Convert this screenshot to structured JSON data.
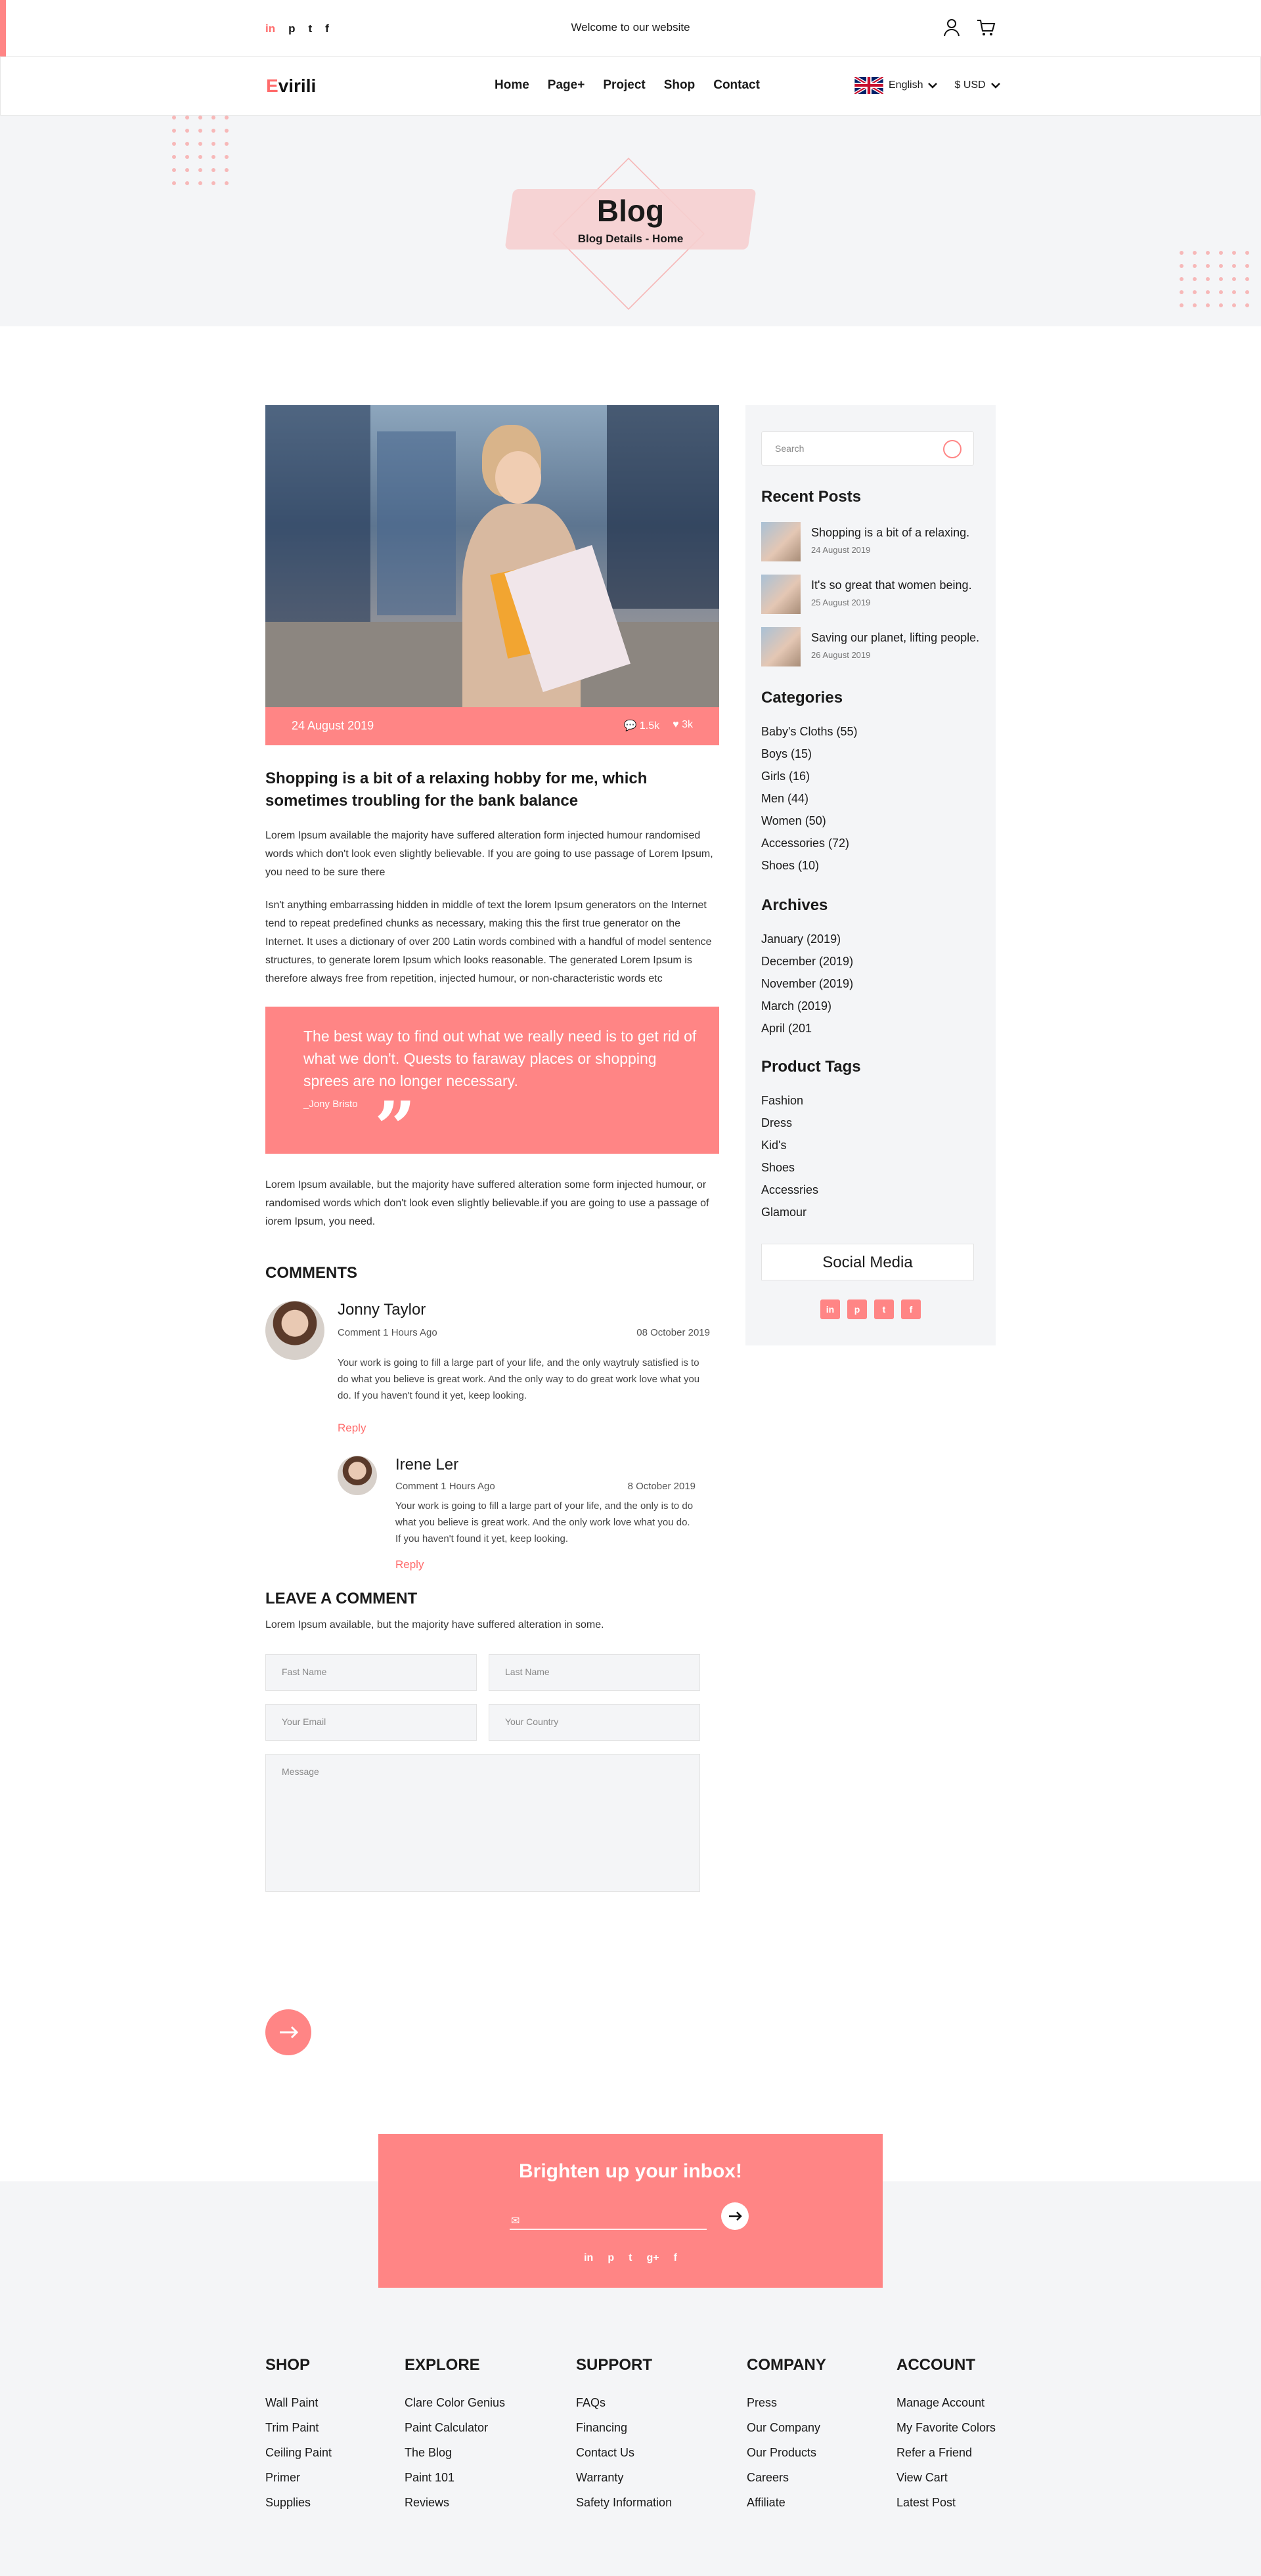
{
  "topbar": {
    "social": [
      "in",
      "p",
      "t",
      "f"
    ],
    "welcome": "Welcome to our website",
    "icons": [
      "user-icon",
      "cart-icon"
    ]
  },
  "nav": {
    "logo_first": "E",
    "logo_rest": "virili",
    "menu": [
      "Home",
      "Page+",
      "Project",
      "Shop",
      "Contact"
    ],
    "language": "English",
    "currency": "$ USD"
  },
  "hero": {
    "title": "Blog",
    "breadcrumb": "Blog Details - Home"
  },
  "post": {
    "date": "24 August 2019",
    "comments_count": "1.5k",
    "likes_count": "3k",
    "title": "Shopping is a bit of a relaxing hobby for me, which sometimes troubling for the bank balance",
    "para1": "Lorem Ipsum available the majority have suffered alteration form injected humour randomised words which don't look even slightly believable. If you are going to use passage of Lorem Ipsum, you need to be sure there",
    "para2": "Isn't anything embarrassing hidden in middle of text  the lorem Ipsum generators on the Internet tend to repeat predefined chunks as necessary, making this the first true generator on the Internet. It uses a dictionary of over 200 Latin words combined with a handful of model sentence structures, to generate lorem Ipsum which looks reasonable. The generated Lorem Ipsum is therefore always free from repetition, injected humour, or non-characteristic words etc",
    "quote": "The best way to find out what we really need is to get rid of what we don't. Quests to faraway places or shopping sprees are no longer necessary.",
    "quote_author": "_Jony Bristo",
    "para3": "Lorem Ipsum available, but the majority have suffered alteration some form injected humour, or randomised words which don't look even slightly believable.if you are going to use a passage of iorem Ipsum, you need."
  },
  "comments": {
    "heading": "COMMENTS",
    "items": [
      {
        "name": "Jonny Taylor",
        "meta": "Comment 1 Hours Ago",
        "date": "08 October 2019",
        "text": "Your work is going to fill a large part of your life, and the only waytruly satisfied is to do what you believe is great work. And the only way to do great work love what you do. If you haven't found it yet, keep looking.",
        "reply": "Reply"
      },
      {
        "name": "Irene Ler",
        "meta": "Comment 1 Hours Ago",
        "date": "8 October 2019",
        "text": "Your work is going to fill a large part of your life, and the only is to do what you believe is great work. And the only work love what you do. If you haven't found it yet, keep looking.",
        "reply": "Reply"
      }
    ]
  },
  "leave": {
    "heading": "LEAVE A COMMENT",
    "sub": "Lorem Ipsum available, but the majority have suffered alteration in some.",
    "first_name": "Fast Name",
    "last_name": "Last Name",
    "email": "Your Email",
    "country": "Your Country",
    "message": "Message"
  },
  "sidebar": {
    "search_placeholder": "Search",
    "recent_heading": "Recent Posts",
    "recent": [
      {
        "title": "Shopping is a bit of a relaxing.",
        "date": "24 August 2019"
      },
      {
        "title": "It's so great that women being.",
        "date": "25 August 2019"
      },
      {
        "title": "Saving our planet, lifting people.",
        "date": "26 August 2019"
      }
    ],
    "categories_heading": "Categories",
    "categories": [
      "Baby's Cloths (55)",
      "Boys (15)",
      "Girls (16)",
      "Men (44)",
      "Women (50)",
      "Accessories (72)",
      "Shoes (10)"
    ],
    "archives_heading": "Archives",
    "archives": [
      "January (2019)",
      "December (2019)",
      "November (2019)",
      "March (2019)",
      "April (201"
    ],
    "tags_heading": "Product Tags",
    "tags": [
      "Fashion",
      "Dress",
      "Kid's",
      "Shoes",
      "Accessries",
      "Glamour"
    ],
    "social_heading": "Social Media",
    "social": [
      "in",
      "p",
      "t",
      "f"
    ]
  },
  "newsletter": {
    "title": "Brighten up your inbox!",
    "social": [
      "in",
      "p",
      "t",
      "g+",
      "f"
    ]
  },
  "footer": {
    "columns": [
      {
        "heading": "SHOP",
        "links": [
          "Wall Paint",
          "Trim Paint",
          "Ceiling Paint",
          "Primer",
          "Supplies"
        ]
      },
      {
        "heading": "EXPLORE",
        "links": [
          "Clare Color Genius",
          "Paint Calculator",
          "The Blog",
          "Paint 101",
          "Reviews"
        ]
      },
      {
        "heading": "SUPPORT",
        "links": [
          "FAQs",
          "Financing",
          "Contact Us",
          "Warranty",
          "Safety Information"
        ]
      },
      {
        "heading": "COMPANY",
        "links": [
          "Press",
          "Our Company",
          "Our Products",
          "Careers",
          "Affiliate"
        ]
      },
      {
        "heading": "ACCOUNT",
        "links": [
          "Manage Account",
          "My Favorite Colors",
          "Refer a Friend",
          "View Cart",
          "Latest Post"
        ]
      }
    ]
  },
  "colors": {
    "accent": "#ff8585",
    "background_light": "#f4f5f7"
  }
}
